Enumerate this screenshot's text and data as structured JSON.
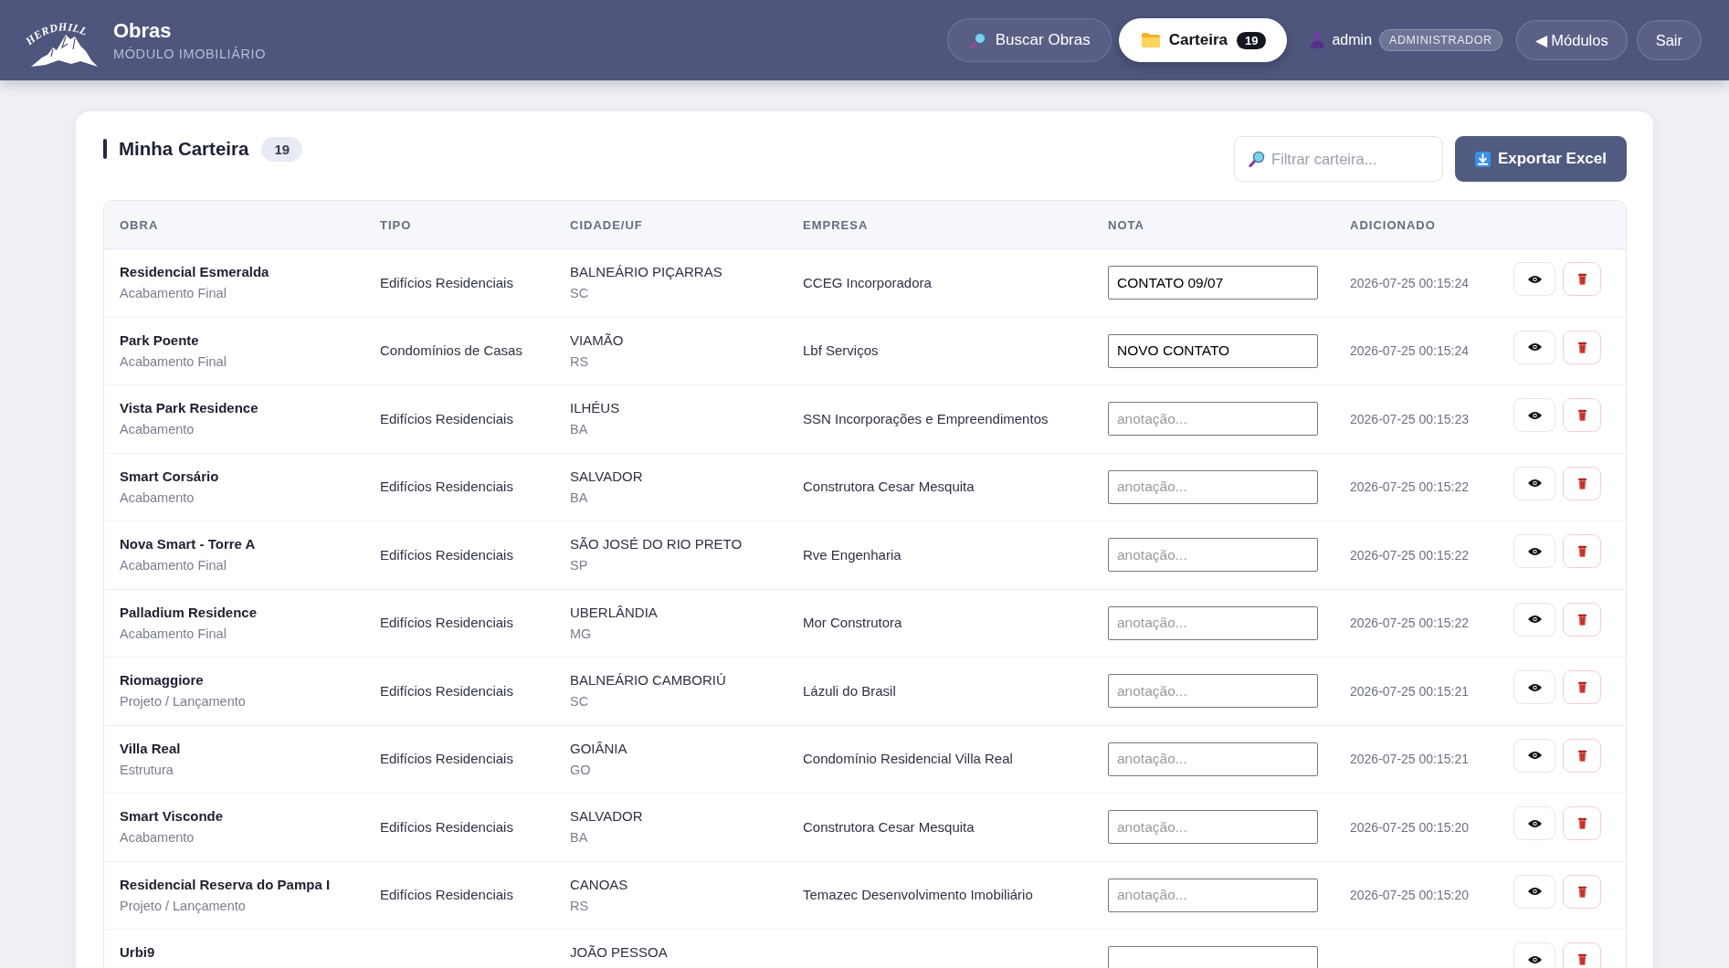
{
  "header": {
    "logo_text": "HERDHILL",
    "title": "Obras",
    "subtitle": "MÓDULO IMOBILIÁRIO",
    "nav": [
      {
        "label": "Buscar Obras",
        "selected": false
      },
      {
        "label": "Carteira",
        "selected": true,
        "badge": "19"
      }
    ],
    "user": {
      "name": "admin",
      "role": "ADMINISTRADOR"
    },
    "buttons": [
      "◀ Módulos",
      "Sair"
    ]
  },
  "portfolio": {
    "title": "Minha Carteira",
    "count": "19",
    "filter": {
      "placeholder": "Filtrar carteira..."
    },
    "export_button": "Exportar Excel",
    "table": {
      "columns": [
        "OBRA",
        "TIPO",
        "CIDADE/UF",
        "EMPRESA",
        "NOTA",
        "ADICIONADO"
      ],
      "rows": [
        {
          "name": "Residencial Esmeralda",
          "stage": "Acabamento Final",
          "type": "Edifícios Residenciais",
          "city": "BALNEÁRIO PIÇARRAS",
          "uf": "SC",
          "company": "CCEG Incorporadora",
          "note": {
            "value": "CONTATO 09/07"
          },
          "added": "2026-07-25 00:15:24"
        },
        {
          "name": "Park Poente",
          "stage": "Acabamento Final",
          "type": "Condomínios de Casas",
          "city": "VIAMÃO",
          "uf": "RS",
          "company": "Lbf Serviços",
          "note": {
            "value": "NOVO CONTATO"
          },
          "added": "2026-07-25 00:15:24"
        },
        {
          "name": "Vista Park Residence",
          "stage": "Acabamento",
          "type": "Edifícios Residenciais",
          "city": "ILHÉUS",
          "uf": "BA",
          "company": "SSN Incorporações e Empreendimentos",
          "note": {
            "placeholder": "anotação..."
          },
          "added": "2026-07-25 00:15:23"
        },
        {
          "name": "Smart Corsário",
          "stage": "Acabamento",
          "type": "Edifícios Residenciais",
          "city": "SALVADOR",
          "uf": "BA",
          "company": "Construtora Cesar Mesquita",
          "note": {
            "placeholder": "anotação..."
          },
          "added": "2026-07-25 00:15:22"
        },
        {
          "name": "Nova Smart - Torre A",
          "stage": "Acabamento Final",
          "type": "Edifícios Residenciais",
          "city": "SÃO JOSÉ DO RIO PRETO",
          "uf": "SP",
          "company": "Rve Engenharia",
          "note": {
            "placeholder": "anotação..."
          },
          "added": "2026-07-25 00:15:22"
        },
        {
          "name": "Palladium Residence",
          "stage": "Acabamento Final",
          "type": "Edifícios Residenciais",
          "city": "UBERLÂNDIA",
          "uf": "MG",
          "company": "Mor Construtora",
          "note": {
            "placeholder": "anotação..."
          },
          "added": "2026-07-25 00:15:22"
        },
        {
          "name": "Riomaggiore",
          "stage": "Projeto / Lançamento",
          "type": "Edifícios Residenciais",
          "city": "BALNEÁRIO CAMBORIÚ",
          "uf": "SC",
          "company": "Lázuli do Brasil",
          "note": {
            "placeholder": "anotação..."
          },
          "added": "2026-07-25 00:15:21"
        },
        {
          "name": "Villa Real",
          "stage": "Estrutura",
          "type": "Edifícios Residenciais",
          "city": "GOIÂNIA",
          "uf": "GO",
          "company": "Condomínio Residencial Villa Real",
          "note": {
            "placeholder": "anotação..."
          },
          "added": "2026-07-25 00:15:21"
        },
        {
          "name": "Smart Visconde",
          "stage": "Acabamento",
          "type": "Edifícios Residenciais",
          "city": "SALVADOR",
          "uf": "BA",
          "company": "Construtora Cesar Mesquita",
          "note": {
            "placeholder": "anotação..."
          },
          "added": "2026-07-25 00:15:20"
        },
        {
          "name": "Residencial Reserva do Pampa I",
          "stage": "Projeto / Lançamento",
          "type": "Edifícios Residenciais",
          "city": "CANOAS",
          "uf": "RS",
          "company": "Temazec Desenvolvimento Imobiliário",
          "note": {
            "placeholder": "anotação..."
          },
          "added": "2026-07-25 00:15:20"
        },
        {
          "name": "Urbi9",
          "city": "JOÃO PESSOA",
          "note": {}
        }
      ]
    }
  }
}
